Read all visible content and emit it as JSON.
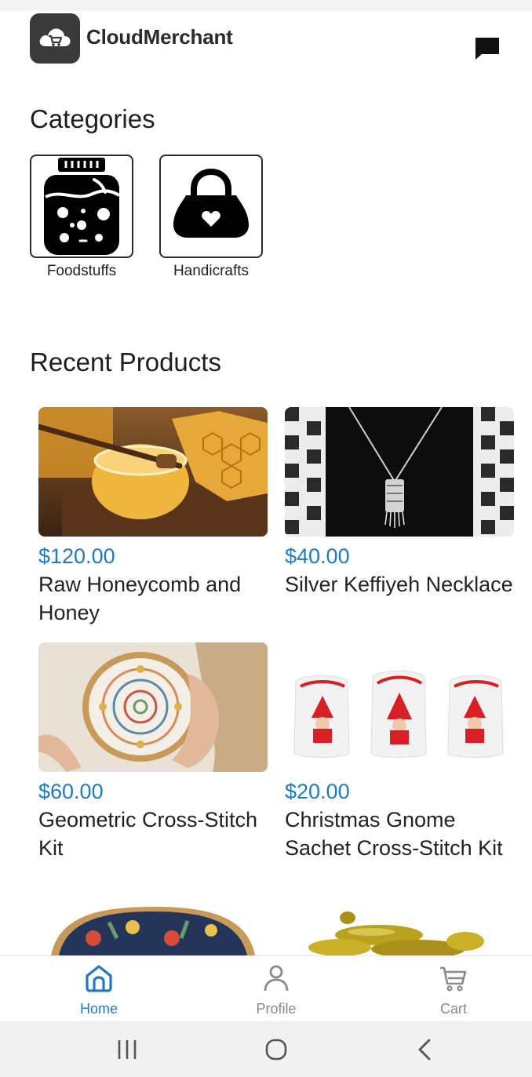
{
  "header": {
    "app_name": "CloudMerchant"
  },
  "categories": {
    "title": "Categories",
    "items": [
      {
        "label": "Foodstuffs",
        "icon": "jar-icon"
      },
      {
        "label": "Handicrafts",
        "icon": "handbag-icon"
      }
    ]
  },
  "recent": {
    "title": "Recent Products",
    "products": [
      {
        "price": "$120.00",
        "name": "Raw Honeycomb and Honey"
      },
      {
        "price": "$40.00",
        "name": "Silver Keffiyeh Necklace"
      },
      {
        "price": "$60.00",
        "name": "Geometric Cross-Stitch Kit"
      },
      {
        "price": "$20.00",
        "name": "Christmas Gnome Sachet Cross-Stitch Kit"
      }
    ]
  },
  "bottom_nav": {
    "items": [
      {
        "label": "Home",
        "icon": "home-icon",
        "active": true
      },
      {
        "label": "Profile",
        "icon": "person-icon",
        "active": false
      },
      {
        "label": "Cart",
        "icon": "cart-icon",
        "active": false
      }
    ]
  },
  "colors": {
    "accent": "#1f7ac4",
    "logo_bg": "#3a3a3a"
  }
}
